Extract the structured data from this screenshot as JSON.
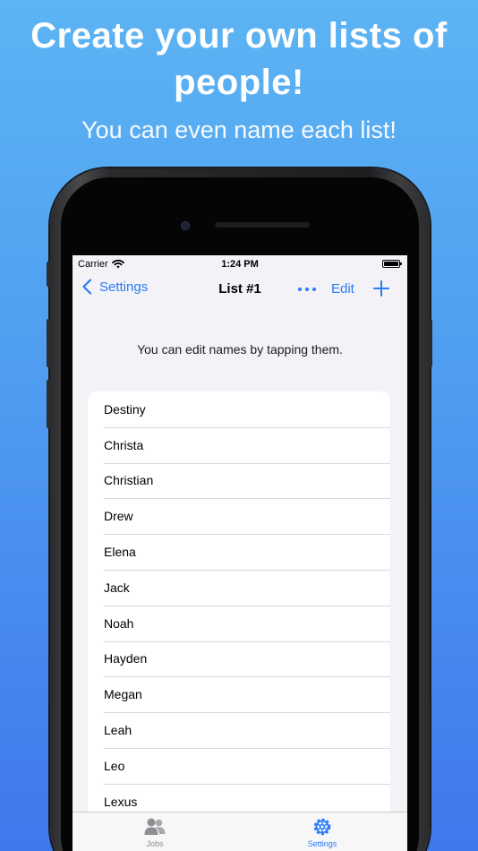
{
  "promo": {
    "headline_line1": "Create your own lists of",
    "headline_line2": "people!",
    "subheadline": "You can even name each list!"
  },
  "status_bar": {
    "carrier": "Carrier",
    "time": "1:24 PM"
  },
  "nav": {
    "back_label": "Settings",
    "title": "List #1",
    "edit_label": "Edit",
    "icons": {
      "back": "chevron-left-icon",
      "more": "ellipsis-icon",
      "add": "plus-icon"
    }
  },
  "hint": "You can edit names by tapping them.",
  "people": [
    {
      "name": "Destiny"
    },
    {
      "name": "Christa"
    },
    {
      "name": "Christian"
    },
    {
      "name": "Drew"
    },
    {
      "name": "Elena"
    },
    {
      "name": "Jack"
    },
    {
      "name": "Noah"
    },
    {
      "name": "Hayden"
    },
    {
      "name": "Megan"
    },
    {
      "name": "Leah"
    },
    {
      "name": "Leo"
    },
    {
      "name": "Lexus"
    }
  ],
  "tabs": {
    "jobs_label": "Jobs",
    "settings_label": "Settings",
    "selected": "Settings"
  },
  "colors": {
    "accent": "#2a7bf6",
    "background_top": "#5cb4f3",
    "background_bottom": "#3f78ec",
    "screen_background": "#f2f2f7",
    "tab_inactive": "#8e8e93"
  }
}
